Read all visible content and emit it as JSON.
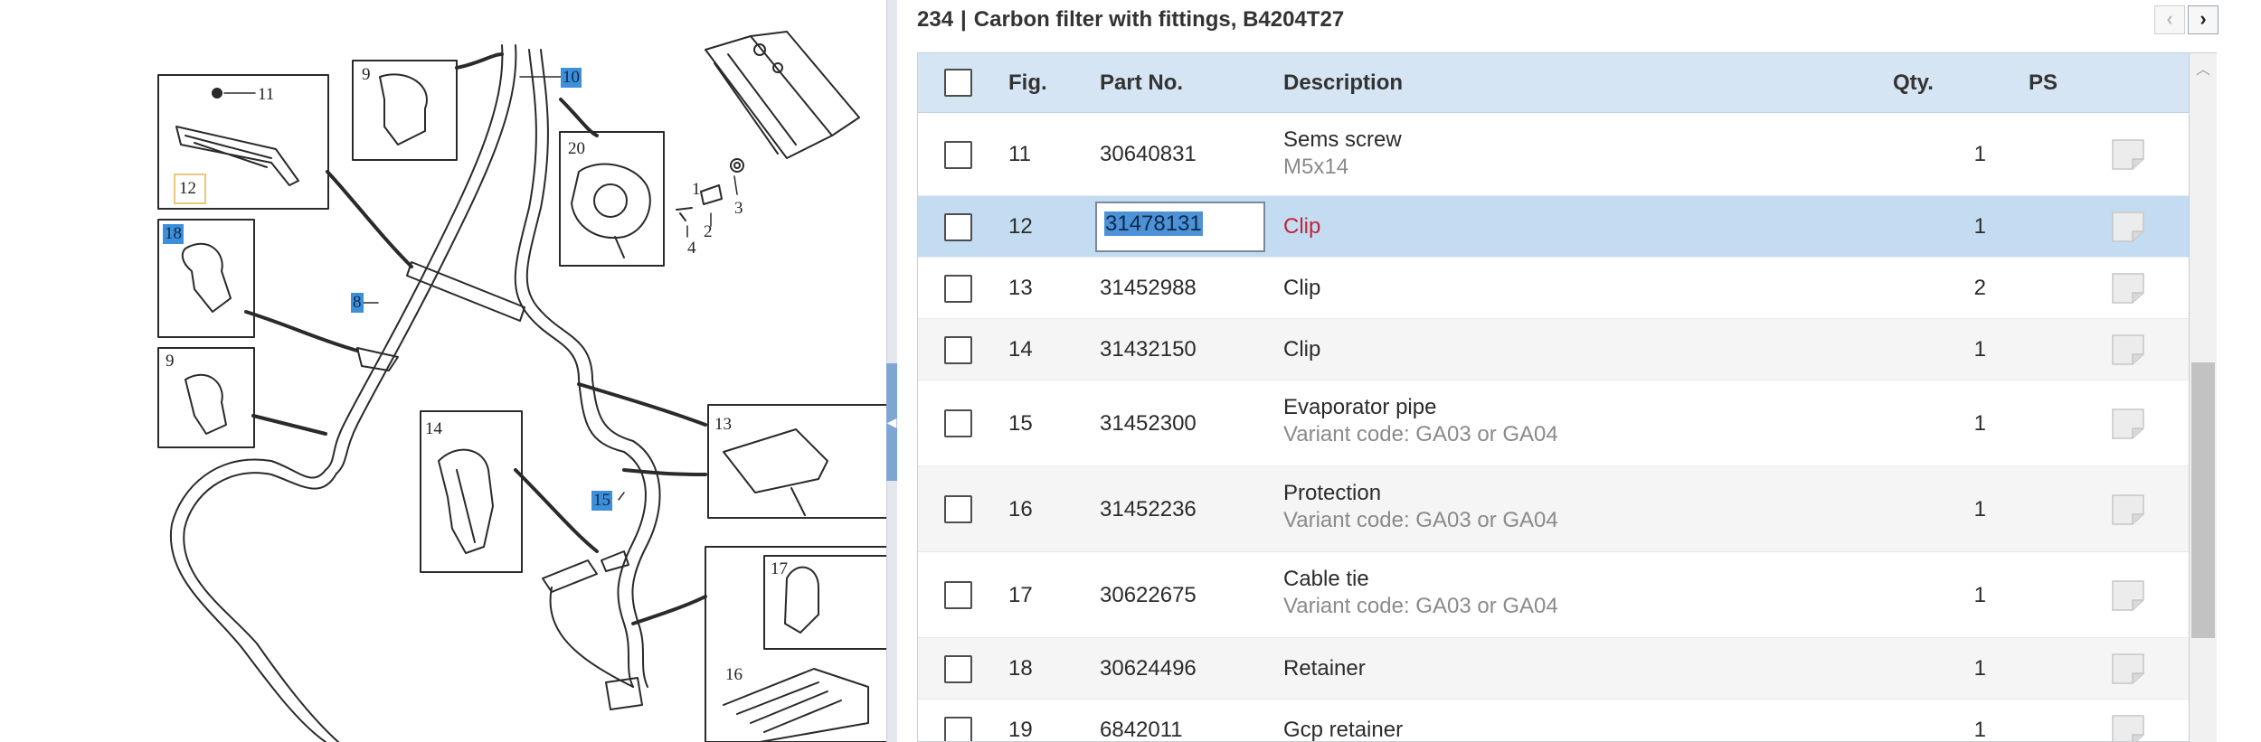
{
  "group": {
    "number": "234",
    "title": "Carbon filter with fittings, B4204T27"
  },
  "nav": {
    "prev_icon": "chevron-left-icon",
    "next_icon": "chevron-right-icon",
    "prev_glyph": "‹",
    "next_glyph": "›"
  },
  "splitter": {
    "glyph": "◀"
  },
  "columns": {
    "fig": "Fig.",
    "part_no": "Part No.",
    "description": "Description",
    "qty": "Qty.",
    "ps": "PS"
  },
  "rows": [
    {
      "fig": "11",
      "part_no": "30640831",
      "description": "Sems screw",
      "sub": "M5x14",
      "qty": "1"
    },
    {
      "fig": "12",
      "part_no": "31478131",
      "description": "Clip",
      "sub": "",
      "qty": "1",
      "selected": true
    },
    {
      "fig": "13",
      "part_no": "31452988",
      "description": "Clip",
      "sub": "",
      "qty": "2"
    },
    {
      "fig": "14",
      "part_no": "31432150",
      "description": "Clip",
      "sub": "",
      "qty": "1"
    },
    {
      "fig": "15",
      "part_no": "31452300",
      "description": "Evaporator pipe",
      "sub": "Variant code: GA03 or GA04",
      "qty": "1"
    },
    {
      "fig": "16",
      "part_no": "31452236",
      "description": "Protection",
      "sub": "Variant code: GA03 or GA04",
      "qty": "1"
    },
    {
      "fig": "17",
      "part_no": "30622675",
      "description": "Cable tie",
      "sub": "Variant code: GA03 or GA04",
      "qty": "1"
    },
    {
      "fig": "18",
      "part_no": "30624496",
      "description": "Retainer",
      "sub": "",
      "qty": "1"
    },
    {
      "fig": "19",
      "part_no": "6842011",
      "description": "Gcp retainer",
      "sub": "",
      "qty": "1"
    }
  ],
  "diagram": {
    "labels": [
      "11",
      "12",
      "18",
      "9",
      "9",
      "10",
      "20",
      "8",
      "1",
      "2",
      "3",
      "4",
      "14",
      "13",
      "15",
      "17",
      "16"
    ],
    "highlighted": [
      "10",
      "18",
      "8",
      "15"
    ],
    "boxed": [
      "12"
    ]
  },
  "colors": {
    "selected_row": "#c3dcf2",
    "header_bg": "#d6e5f3",
    "highlight_label": "#3d8fd9",
    "selected_desc": "#c0263a"
  },
  "icons": {
    "ps": "document-icon",
    "scroll_up": "scroll-up-arrow-icon"
  }
}
